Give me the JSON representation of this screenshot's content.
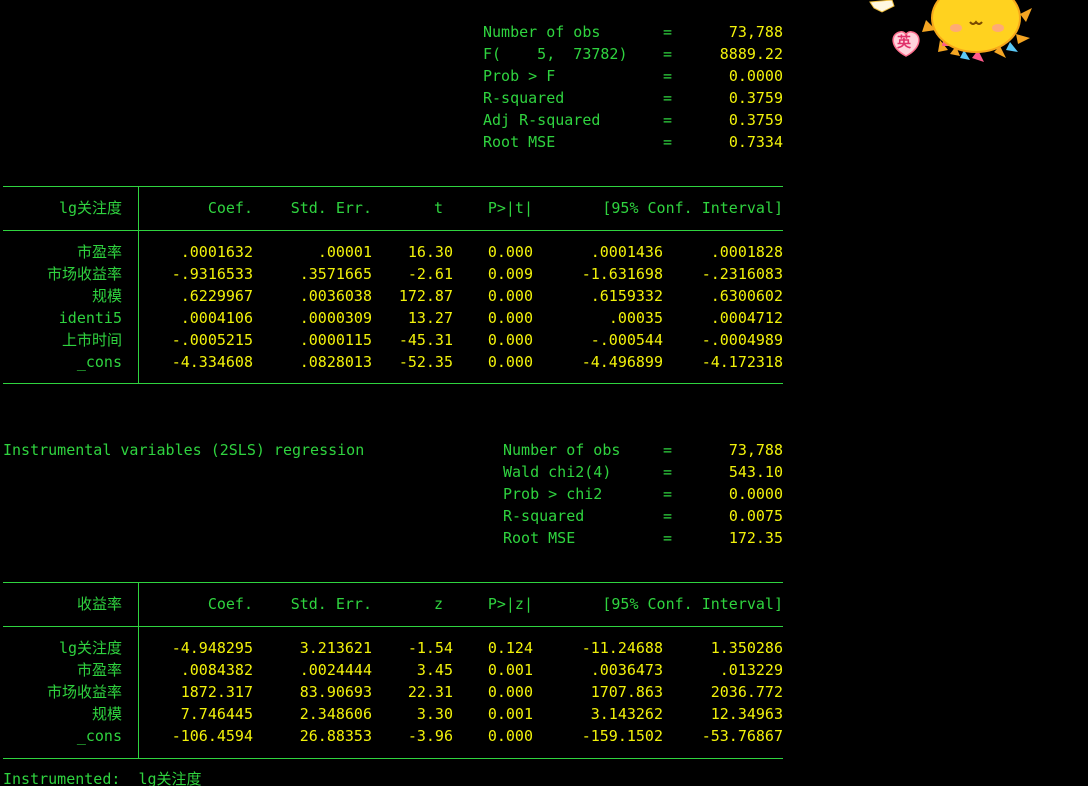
{
  "ols_stats": [
    {
      "label": "Number of obs",
      "eq": "=",
      "value": "73,788"
    },
    {
      "label": "F(    5,  73782)",
      "eq": "=",
      "value": "8889.22"
    },
    {
      "label": "Prob > F",
      "eq": "=",
      "value": "0.0000"
    },
    {
      "label": "R-squared",
      "eq": "=",
      "value": "0.3759"
    },
    {
      "label": "Adj R-squared",
      "eq": "=",
      "value": "0.3759"
    },
    {
      "label": "Root MSE",
      "eq": "=",
      "value": "0.7334"
    }
  ],
  "ols_table": {
    "depvar": "lg关注度",
    "headers": [
      "Coef.",
      "Std. Err.",
      "t",
      "P>|t|",
      "[95% Conf. Interval]"
    ],
    "rows": [
      {
        "var": "市盈率",
        "coef": ".0001632",
        "se": ".00001",
        "stat": "16.30",
        "p": "0.000",
        "lo": ".0001436",
        "hi": ".0001828"
      },
      {
        "var": "市场收益率",
        "coef": "-.9316533",
        "se": ".3571665",
        "stat": "-2.61",
        "p": "0.009",
        "lo": "-1.631698",
        "hi": "-.2316083"
      },
      {
        "var": "规模",
        "coef": ".6229967",
        "se": ".0036038",
        "stat": "172.87",
        "p": "0.000",
        "lo": ".6159332",
        "hi": ".6300602"
      },
      {
        "var": "identi5",
        "coef": ".0004106",
        "se": ".0000309",
        "stat": "13.27",
        "p": "0.000",
        "lo": ".00035",
        "hi": ".0004712"
      },
      {
        "var": "上市时间",
        "coef": "-.0005215",
        "se": ".0000115",
        "stat": "-45.31",
        "p": "0.000",
        "lo": "-.000544",
        "hi": "-.0004989"
      },
      {
        "var": "_cons",
        "coef": "-4.334608",
        "se": ".0828013",
        "stat": "-52.35",
        "p": "0.000",
        "lo": "-4.496899",
        "hi": "-4.172318"
      }
    ]
  },
  "iv_title": "Instrumental variables (2SLS) regression",
  "iv_stats": [
    {
      "label": "Number of obs",
      "eq": "=",
      "value": "73,788"
    },
    {
      "label": "Wald chi2(4)",
      "eq": "=",
      "value": "543.10"
    },
    {
      "label": "Prob > chi2",
      "eq": "=",
      "value": "0.0000"
    },
    {
      "label": "R-squared",
      "eq": "=",
      "value": "0.0075"
    },
    {
      "label": "Root MSE",
      "eq": "=",
      "value": "172.35"
    }
  ],
  "iv_table": {
    "depvar": "收益率",
    "headers": [
      "Coef.",
      "Std. Err.",
      "z",
      "P>|z|",
      "[95% Conf. Interval]"
    ],
    "rows": [
      {
        "var": "lg关注度",
        "coef": "-4.948295",
        "se": "3.213621",
        "stat": "-1.54",
        "p": "0.124",
        "lo": "-11.24688",
        "hi": "1.350286"
      },
      {
        "var": "市盈率",
        "coef": ".0084382",
        "se": ".0024444",
        "stat": "3.45",
        "p": "0.001",
        "lo": ".0036473",
        "hi": ".013229"
      },
      {
        "var": "市场收益率",
        "coef": "1872.317",
        "se": "83.90693",
        "stat": "22.31",
        "p": "0.000",
        "lo": "1707.863",
        "hi": "2036.772"
      },
      {
        "var": "规模",
        "coef": "7.746445",
        "se": "2.348606",
        "stat": "3.30",
        "p": "0.001",
        "lo": "3.143262",
        "hi": "12.34963"
      },
      {
        "var": "_cons",
        "coef": "-106.4594",
        "se": "26.88353",
        "stat": "-3.96",
        "p": "0.000",
        "lo": "-159.1502",
        "hi": "-53.76867"
      }
    ]
  },
  "instrumented_line": "Instrumented:  lg关注度",
  "sticker": {
    "badge_text": "英",
    "icon": "sun-sticker-icon"
  },
  "colors": {
    "background": "#000000",
    "green": "#2fd33f",
    "yellow": "#f2f20a"
  }
}
